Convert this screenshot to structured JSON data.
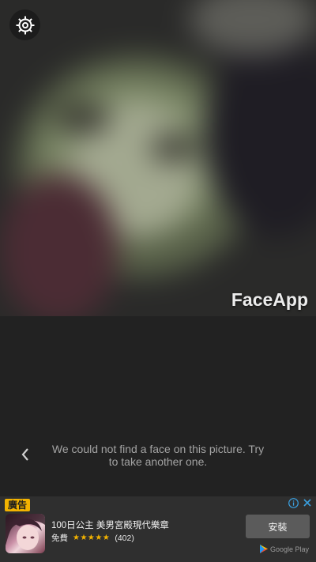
{
  "photo": {
    "watermark": "FaceApp",
    "settings_icon": "gear-icon"
  },
  "message": {
    "text": "We could not find a face on this picture. Try to take another one.",
    "back_icon": "chevron-left-icon"
  },
  "ad": {
    "badge": "廣告",
    "info_icon": "info-icon",
    "close_icon": "close-icon",
    "app_title": "100日公主 美男宮殿現代樂章",
    "price": "免費",
    "stars": "★★★★★",
    "rating_count": "(402)",
    "install_label": "安裝",
    "store_label": "Google Play",
    "store_icon": "play-store-icon"
  },
  "colors": {
    "background": "#222222",
    "ad_background": "#2f2f2f",
    "ad_badge": "#f3b300",
    "install_button": "#5b5b5b"
  }
}
